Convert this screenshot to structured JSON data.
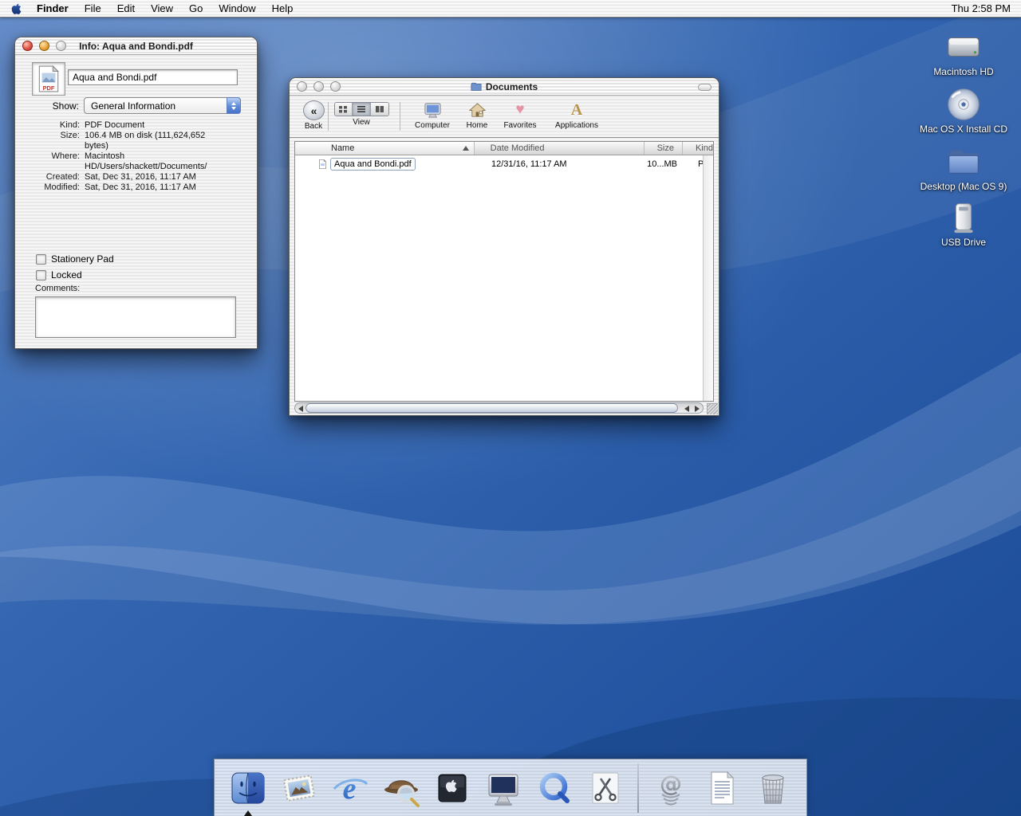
{
  "menu_bar": {
    "items": [
      "Finder",
      "File",
      "Edit",
      "View",
      "Go",
      "Window",
      "Help"
    ],
    "clock": "Thu 2:58 PM"
  },
  "info_window": {
    "title": "Info: Aqua and Bondi.pdf",
    "filename": "Aqua and Bondi.pdf",
    "file_type_badge": "PDF",
    "show_label": "Show:",
    "show_value": "General Information",
    "fields": [
      {
        "label": "Kind:",
        "value": "PDF Document"
      },
      {
        "label": "Size:",
        "value": "106.4 MB on disk (111,624,652 bytes)"
      },
      {
        "label": "Where:",
        "value": "Macintosh HD/Users/shackett/Documents/"
      },
      {
        "label": "Created:",
        "value": "Sat, Dec 31, 2016, 11:17 AM"
      },
      {
        "label": "Modified:",
        "value": "Sat, Dec 31, 2016, 11:17 AM"
      }
    ],
    "checkbox_stationery": "Stationery Pad",
    "checkbox_locked": "Locked",
    "comments_label": "Comments:"
  },
  "finder_window": {
    "title": "Documents",
    "toolbar": {
      "back": "Back",
      "view": "View",
      "computer": "Computer",
      "home": "Home",
      "favorites": "Favorites",
      "applications": "Applications"
    },
    "columns": [
      "Name",
      "Date Modified",
      "Size",
      "Kind"
    ],
    "row": {
      "name": "Aqua and Bondi.pdf",
      "date_modified": "12/31/16, 11:17 AM",
      "size": "10...MB",
      "kind": "PD"
    }
  },
  "desktop_icons": [
    {
      "label": "Macintosh HD"
    },
    {
      "label": "Mac OS X Install CD"
    },
    {
      "label": "Desktop (Mac OS 9)"
    },
    {
      "label": "USB Drive"
    }
  ],
  "dock_items": [
    "finder",
    "mail",
    "internet-explorer",
    "sherlock",
    "system-preferences",
    "displays",
    "quicktime-player",
    "scissors",
    "at-spring",
    "textedit",
    "trash"
  ]
}
